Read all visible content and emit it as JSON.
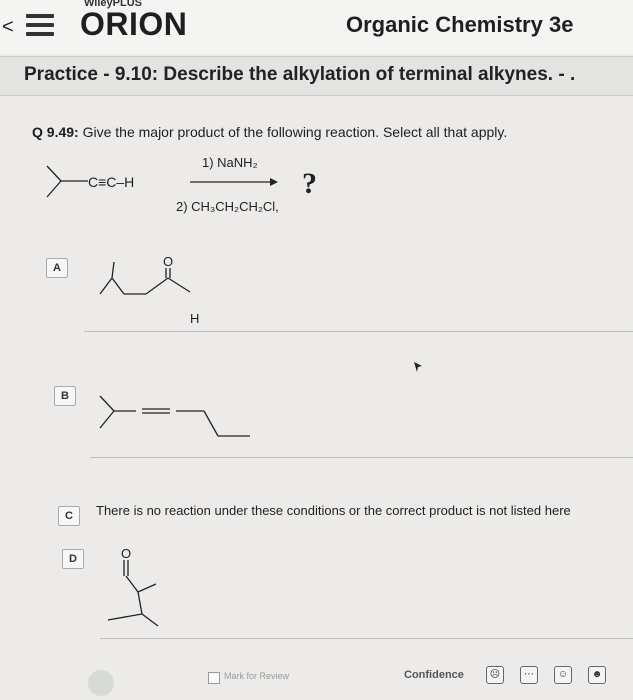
{
  "header": {
    "brand": "WileyPLUS",
    "app_title": "ORION",
    "course_title": "Organic Chemistry 3e",
    "back_glyph": "<"
  },
  "practice": {
    "title": "Practice - 9.10: Describe the alkylation of terminal alkynes. - ."
  },
  "question": {
    "number": "Q 9.49:",
    "prompt": "Give the major product of the following reaction. Select all that apply.",
    "reactant_label": "C≡C–H",
    "step1": "1) NaNH₂",
    "step2": "2) CH₃CH₂CH₂Cl,",
    "unknown": "?"
  },
  "options": [
    {
      "letter": "A",
      "atom_o": "O",
      "atom_h": "H"
    },
    {
      "letter": "B"
    },
    {
      "letter": "C",
      "text": "There is no reaction under these conditions or the correct product is not listed here"
    },
    {
      "letter": "D",
      "atom_o": "O"
    }
  ],
  "footer": {
    "mark_for_review": "Mark for Review",
    "confidence_label": "Confidence",
    "confidence_icons": [
      "sad-face-icon",
      "neutral-face-icon",
      "smile-face-icon",
      "happy-face-icon"
    ]
  }
}
